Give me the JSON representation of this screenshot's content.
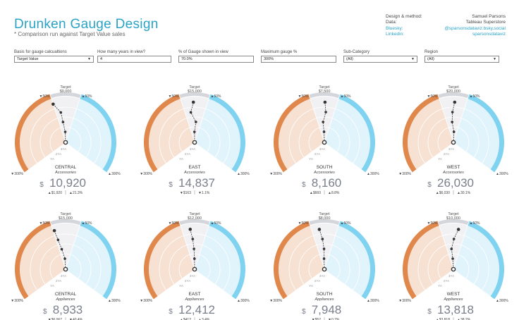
{
  "header": {
    "title": "Drunken Gauge Design",
    "subtitle": "* Comparison run against Target Value sales"
  },
  "credits": [
    {
      "key": "Design & method:",
      "value": "Samuel Parsons",
      "link": false
    },
    {
      "key": "Data:",
      "value": "Tableau Superstore",
      "link": false
    },
    {
      "key": "Bluesky:",
      "value": "@sparsonsdataviz.bsky.social",
      "link": true
    },
    {
      "key": "Linkedin:",
      "value": "sparsonsdataviz",
      "link": true
    }
  ],
  "filters": [
    {
      "label": "Basis for gauge calcualtions",
      "value": "Target Value",
      "dropdown": true
    },
    {
      "label": "How many years in view?",
      "value": "4",
      "dropdown": false
    },
    {
      "label": "% of Gauge shown in view",
      "value": "70.0%",
      "dropdown": false
    },
    {
      "label": "Maximum gauge %",
      "value": "300%",
      "dropdown": false
    },
    {
      "label": "Sub-Category",
      "value": "(All)",
      "dropdown": true
    },
    {
      "label": "Region",
      "value": "(All)",
      "dropdown": true
    }
  ],
  "gauge_labels": {
    "target": "Target",
    "minus50": "▼50%",
    "plus50": "▲50%",
    "minus300": "▼300%",
    "plus300": "▲300%",
    "ya": "YA",
    "ya2": "2YA",
    "ya3": "3YA"
  },
  "colors": {
    "accent": "#2aa3c6",
    "below": "#e0874c",
    "above": "#7fd3f0"
  },
  "gauges": [
    {
      "region": "CENTRAL",
      "subcat": "Accessories",
      "target": "$9,000",
      "value": "10,920",
      "delta": "▲$1,920",
      "pct": "▲21.3%",
      "pos": [
        -1,
        -0.5,
        -0.4,
        -0.1,
        0.2
      ]
    },
    {
      "region": "EAST",
      "subcat": "Accessories",
      "target": "$15,000",
      "value": "14,837",
      "delta": "▼$163",
      "pct": "▼1.1%",
      "pos": [
        -0.1,
        -0.4,
        0.2,
        -0.05,
        0.05
      ]
    },
    {
      "region": "SOUTH",
      "subcat": "Accessories",
      "target": "$7,500",
      "value": "8,160",
      "delta": "▲$660",
      "pct": "▲8.8%",
      "pos": [
        0.05,
        0.15,
        -0.2,
        -0.1,
        0.05
      ]
    },
    {
      "region": "WEST",
      "subcat": "Accessories",
      "target": "$20,000",
      "value": "26,030",
      "delta": "▲$6,030",
      "pct": "▲30.1%",
      "pos": [
        0.1,
        -0.1,
        -0.2,
        0.15,
        0.3
      ]
    },
    {
      "region": "CENTRAL",
      "subcat": "Appliances",
      "target": "$15,000",
      "value": "8,933",
      "delta": "▼$6,067",
      "pct": "▼40.4%",
      "pos": [
        -0.9,
        -0.8,
        -0.6,
        -0.2,
        0.1
      ]
    },
    {
      "region": "EAST",
      "subcat": "Appliances",
      "target": "$12,000",
      "value": "12,412",
      "delta": "▲$412",
      "pct": "▲3.4%",
      "pos": [
        -0.35,
        -0.2,
        -0.1,
        -0.05,
        0.05
      ]
    },
    {
      "region": "SOUTH",
      "subcat": "Appliances",
      "target": "$8,000",
      "value": "7,948",
      "delta": "▼$52",
      "pct": "▼0.7%",
      "pos": [
        -0.4,
        -0.2,
        -0.05,
        -0.1,
        0.05
      ]
    },
    {
      "region": "WEST",
      "subcat": "Appliances",
      "target": "$10,000",
      "value": "13,818",
      "delta": "▲$3,818",
      "pct": "▲38.2%",
      "pos": [
        0.4,
        0.05,
        -0.3,
        -0.2,
        0.1
      ]
    }
  ]
}
